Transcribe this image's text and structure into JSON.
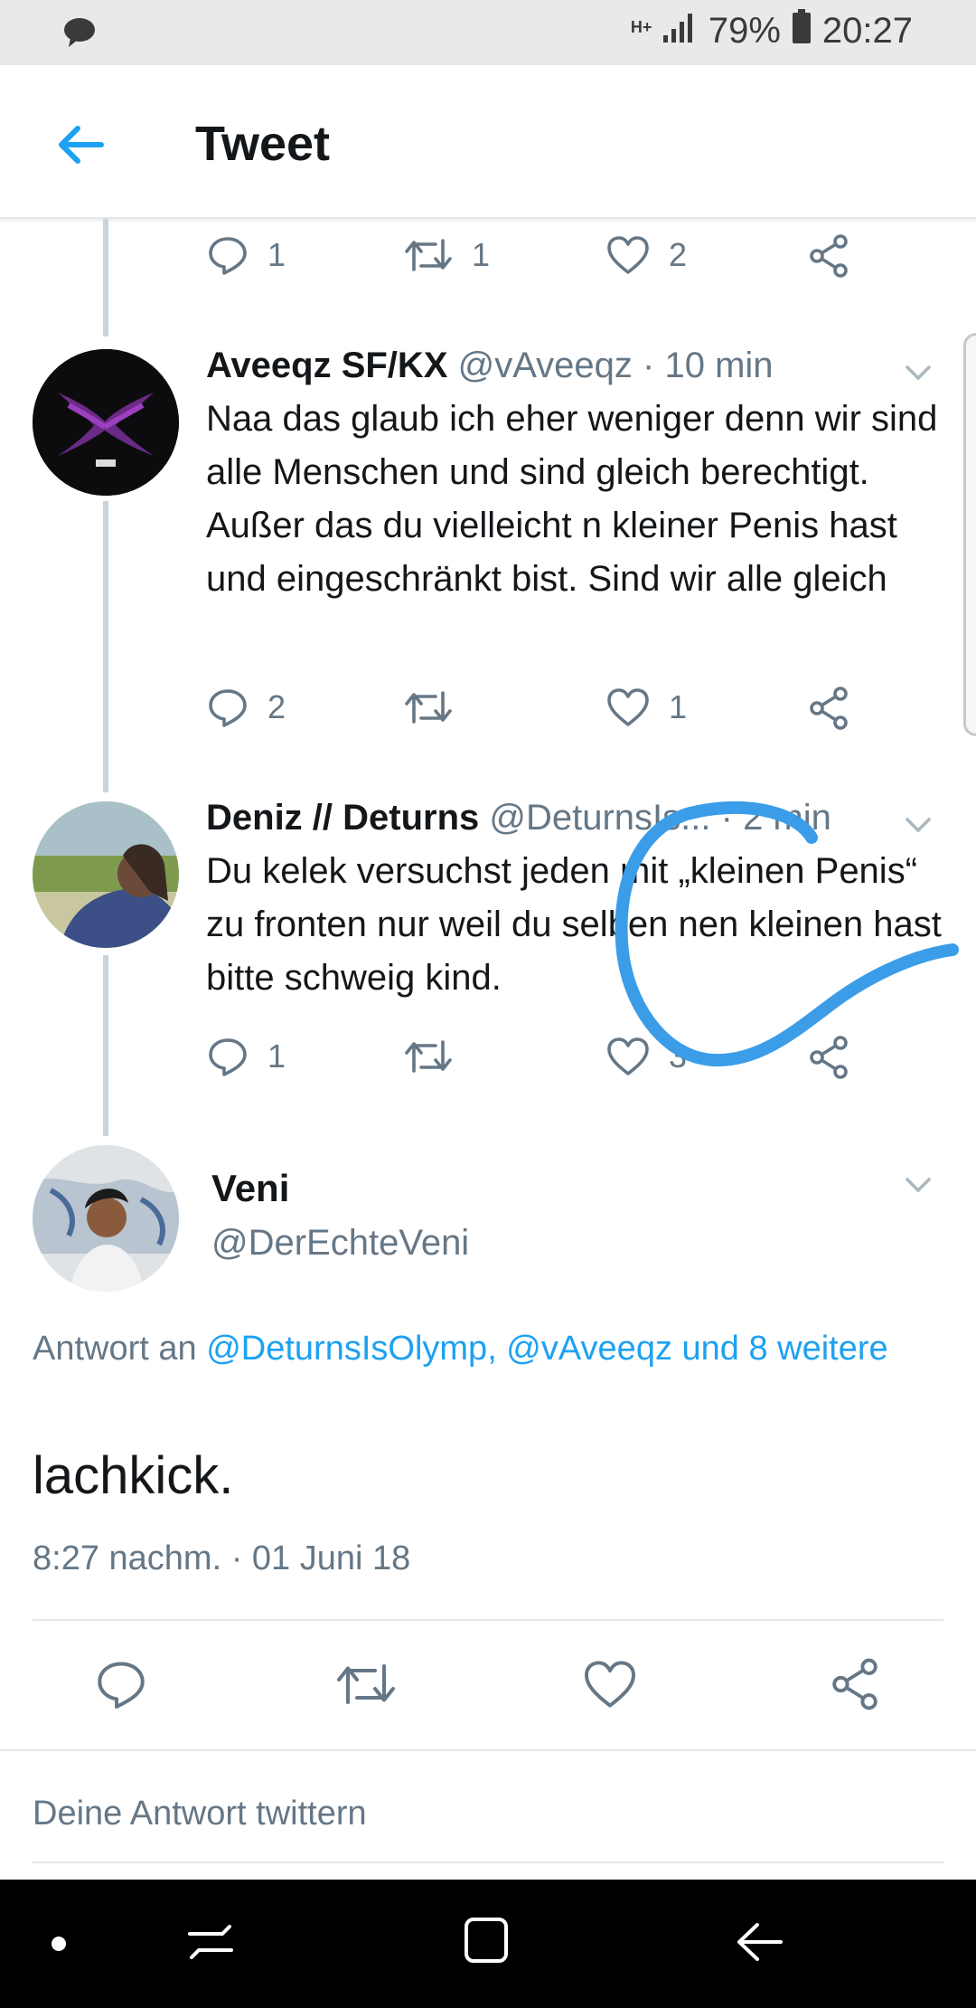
{
  "status_bar": {
    "network": "H+",
    "battery": "79%",
    "time": "20:27"
  },
  "header": {
    "title": "Tweet"
  },
  "top_tweet_actions": {
    "replies": "1",
    "retweets": "1",
    "likes": "2"
  },
  "tweets": [
    {
      "name": "Aveeqz SF/KX",
      "handle": "@vAveeqz",
      "time": "· 10 min",
      "text": "Naa das glaub ich eher weniger denn wir sind alle Menschen und sind gleich berechtigt. Außer das du vielleicht n kleiner Penis hast und eingeschränkt bist. Sind wir alle gleich",
      "replies": "2",
      "retweets": "",
      "likes": "1"
    },
    {
      "name": "Deniz // Deturns",
      "handle": "@DeturnsIs...",
      "time": "· 2 min",
      "text": "Du kelek versuchst jeden mit „kleinen Penis“ zu fronten nur weil du selben nen kleinen hast bitte schweig kind.",
      "replies": "1",
      "retweets": "",
      "likes": "3"
    }
  ],
  "main_tweet": {
    "name": "Veni",
    "handle": "@DerEchteVeni",
    "reply_prefix": "Antwort an ",
    "reply_links": "@DeturnsIsOlymp, @vAveeqz und 8 weitere",
    "text": "lachkick.",
    "timestamp": "8:27 nachm. · 01 Juni 18"
  },
  "reply_placeholder": "Deine Antwort twittern",
  "colors": {
    "accent": "#1da1f2",
    "muted": "#657786",
    "scribble": "#3b9de8"
  },
  "icons": [
    "back-arrow-icon",
    "reply-icon",
    "retweet-icon",
    "like-icon",
    "share-icon",
    "chevron-down-icon"
  ]
}
